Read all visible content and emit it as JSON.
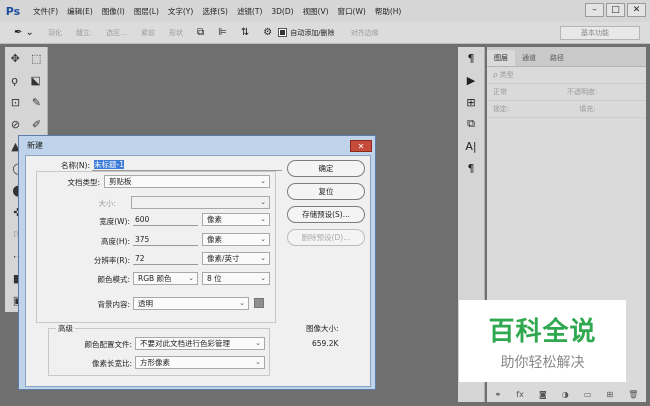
{
  "menubar": {
    "logo": "Ps",
    "items": [
      "文件(F)",
      "编辑(E)",
      "图像(I)",
      "图层(L)",
      "文字(Y)",
      "选择(S)",
      "滤镜(T)",
      "3D(D)",
      "视图(V)",
      "窗口(W)",
      "帮助(H)"
    ],
    "window_controls": [
      "–",
      "□",
      "✕"
    ]
  },
  "optionsbar": {
    "items": [
      "羽化",
      "缝立:",
      "选区...",
      "紧前",
      "形状"
    ],
    "auto_add": "自动添加/删除",
    "align": "对齐边缘",
    "preset": "基本功能"
  },
  "toolbar": {
    "rows": [
      [
        "✥",
        "⬚"
      ],
      [
        "ϙ",
        "⬕"
      ],
      [
        "⊡",
        "✎"
      ],
      [
        "⊘",
        "✐"
      ],
      [
        "▲",
        "◆"
      ],
      [
        "◯",
        ""
      ],
      [
        "⬤",
        ""
      ],
      [
        "✜",
        ""
      ],
      [
        "☞",
        ""
      ],
      [
        "⋯",
        ""
      ],
      [
        "■",
        ""
      ],
      [
        "▣",
        ""
      ]
    ]
  },
  "right_mini": {
    "icons": [
      "¶",
      "▶",
      "⊞",
      "⧉",
      "A|",
      "¶"
    ]
  },
  "layers_panel": {
    "tabs": [
      "图层",
      "通道",
      "路径"
    ],
    "kind_label": "ρ 类型",
    "blend_mode": "正常",
    "opacity": "不透明度:",
    "lock": "锁定:",
    "fill": "填充:"
  },
  "watermark": {
    "title": "百科全说",
    "subtitle": "助你轻松解决"
  },
  "dialog": {
    "title": "新建",
    "close": "✕",
    "name_label": "名称(N):",
    "name_value": "未标题-1",
    "doc_type_label": "文档类型:",
    "doc_type_value": "剪贴板",
    "size_label": "大小:",
    "width_label": "宽度(W):",
    "width_value": "600",
    "width_unit": "像素",
    "height_label": "高度(H):",
    "height_value": "375",
    "height_unit": "像素",
    "res_label": "分辨率(R):",
    "res_value": "72",
    "res_unit": "像素/英寸",
    "color_mode_label": "颜色模式:",
    "color_mode_value": "RGB 颜色",
    "bit_depth": "8 位",
    "bg_label": "背景内容:",
    "bg_value": "透明",
    "advanced_label": "高级",
    "profile_label": "颜色配置文件:",
    "profile_value": "不要对此文档进行色彩管理",
    "aspect_label": "像素长宽比:",
    "aspect_value": "方形像素",
    "image_size_label": "图像大小:",
    "image_size_value": "659.2K",
    "buttons": {
      "ok": "确定",
      "reset": "复位",
      "save_preset": "存储预设(S)...",
      "delete_preset": "删除预设(D)..."
    }
  }
}
